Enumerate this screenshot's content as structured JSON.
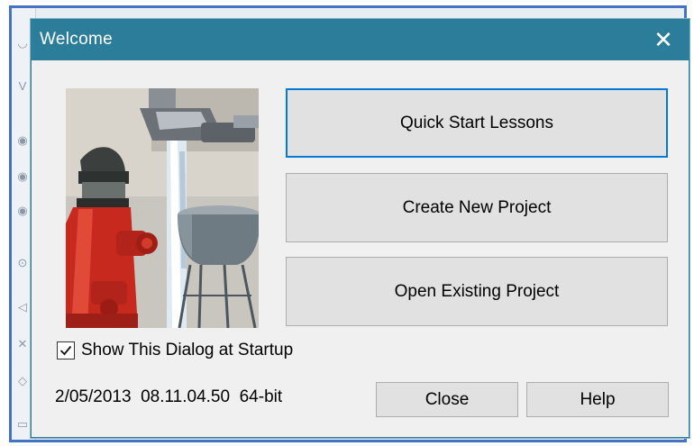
{
  "window": {
    "title": "Welcome",
    "close_glyph": "✕"
  },
  "buttons": {
    "quick_start": "Quick Start Lessons",
    "create_new": "Create New Project",
    "open_existing": "Open Existing Project",
    "close": "Close",
    "help": "Help"
  },
  "startup_option": {
    "label": "Show This Dialog at Startup",
    "checked": true
  },
  "version_info": "2/05/2013  08.11.04.50  64-bit",
  "colors": {
    "titlebar": "#2b7d99",
    "focus_border": "#0078d7",
    "screenshot_frame": "#4472c4"
  },
  "icons": {
    "close": "close-icon",
    "checkbox_mark": "checkmark-icon",
    "welcome_image": "fire-hydrant-water-tower-image"
  }
}
